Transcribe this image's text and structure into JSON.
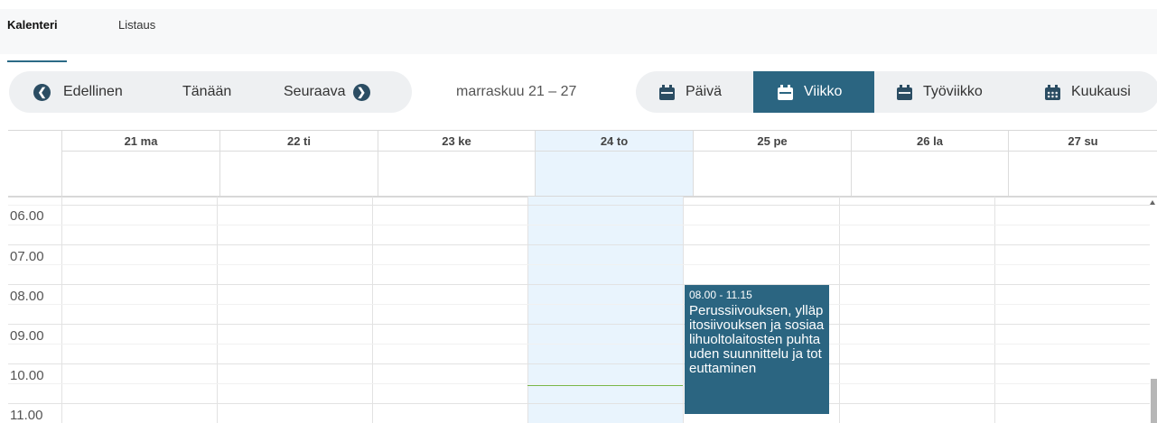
{
  "tabs": [
    {
      "label": "Kalenteri",
      "active": true
    },
    {
      "label": "Listaus",
      "active": false
    }
  ],
  "nav": {
    "prev_label": "Edellinen",
    "today_label": "Tänään",
    "next_label": "Seuraava",
    "prev_icon": "chevron-left-circle-icon",
    "next_icon": "chevron-right-circle-icon"
  },
  "range_label": "marraskuu 21 – 27",
  "views": [
    {
      "label": "Päivä",
      "icon": "calendar-day-icon",
      "active": false
    },
    {
      "label": "Viikko",
      "icon": "calendar-week-icon",
      "active": true
    },
    {
      "label": "Työviikko",
      "icon": "calendar-workweek-icon",
      "active": false
    },
    {
      "label": "Kuukausi",
      "icon": "calendar-month-icon",
      "active": false
    }
  ],
  "days": [
    "21 ma",
    "22 ti",
    "23 ke",
    "24 to",
    "25 pe",
    "26 la",
    "27 su"
  ],
  "today_day": "24 to",
  "hours": [
    "06.00",
    "07.00",
    "08.00",
    "09.00",
    "10.00",
    "11.00"
  ],
  "event": {
    "time": "08.00 - 11.15",
    "title": "Perussiivouksen, ylläpitosiivouksen ja sosiaalihuoltolaitosten puhtauden suunnittelu ja toteuttaminen",
    "day": "25 pe"
  },
  "colors": {
    "accent": "#2b6581",
    "icon": "#2b4d63",
    "today_bg": "#e9f4fd",
    "now_line": "#7ab648"
  }
}
